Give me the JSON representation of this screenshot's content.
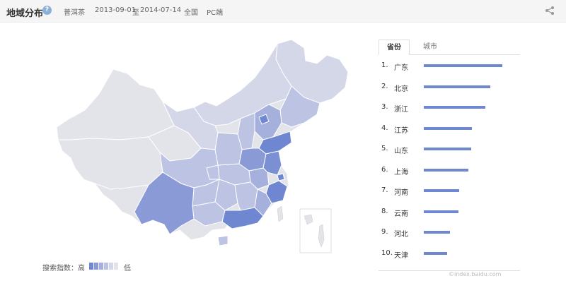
{
  "header": {
    "title": "地域分布",
    "help_icon": "question-circle-icon",
    "keyword": "普洱茶",
    "date_from": "2013-09-01",
    "date_sep": "至",
    "date_to": "2014-07-14",
    "region": "全国",
    "platform": "PC端",
    "share_icon": "share-icon"
  },
  "legend": {
    "label": "搜索指数：高",
    "low": "低",
    "colors": [
      "#6f86d1",
      "#8a9ad6",
      "#a5b0dd",
      "#bcc3e3",
      "#d3d7e8",
      "#e3e4ea"
    ]
  },
  "tabs": [
    {
      "label": "省份",
      "active": true
    },
    {
      "label": "城市",
      "active": false
    }
  ],
  "ranking": [
    {
      "rank": "1.",
      "name": "广东",
      "value": 100
    },
    {
      "rank": "2.",
      "name": "北京",
      "value": 85
    },
    {
      "rank": "3.",
      "name": "浙江",
      "value": 78
    },
    {
      "rank": "4.",
      "name": "江苏",
      "value": 61
    },
    {
      "rank": "5.",
      "name": "山东",
      "value": 60
    },
    {
      "rank": "6.",
      "name": "上海",
      "value": 57
    },
    {
      "rank": "7.",
      "name": "河南",
      "value": 45
    },
    {
      "rank": "8.",
      "name": "云南",
      "value": 44
    },
    {
      "rank": "9.",
      "name": "河北",
      "value": 33
    },
    {
      "rank": "10.",
      "name": "天津",
      "value": 30
    }
  ],
  "colors": {
    "bar": "#6f86d1",
    "map_high": "#6f86d1",
    "map_low": "#e3e4ea"
  },
  "watermark": "©index.baidu.com"
}
